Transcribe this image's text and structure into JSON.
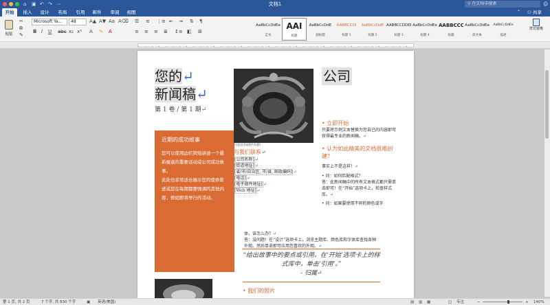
{
  "window": {
    "title": "文档1",
    "search_placeholder": "在文档中搜索"
  },
  "tabs": [
    {
      "label": "开始",
      "active": true
    },
    {
      "label": "插入"
    },
    {
      "label": "设计"
    },
    {
      "label": "布局"
    },
    {
      "label": "引用"
    },
    {
      "label": "邮件"
    },
    {
      "label": "审阅"
    },
    {
      "label": "视图"
    }
  ],
  "share_label": "共享",
  "ribbon": {
    "paste_label": "粘贴",
    "font_name": "Microsoft Ya...",
    "font_size": "48",
    "styles": [
      {
        "sample": "AaBbCcDdEe",
        "name": "正文"
      },
      {
        "sample": "AAI",
        "name": "标题"
      },
      {
        "sample": "AaBbCcDdE",
        "name": "副标题"
      },
      {
        "sample": "AABBCCDI",
        "name": "标题 1"
      },
      {
        "sample": "AaBbCcDdE",
        "name": "标题 2"
      },
      {
        "sample": "AABBCCDDEE",
        "name": "标题 3"
      },
      {
        "sample": "AaBbCcDdEe",
        "name": "标题 4"
      },
      {
        "sample": "AABBCCC",
        "name": "标题"
      },
      {
        "sample": "AaBbCcDdEe",
        "name": "段文本"
      },
      {
        "sample": "AaBbCcDdEe",
        "name": "描述"
      }
    ],
    "styles_pane_label": "样式窗格"
  },
  "document": {
    "title_line1": "您的",
    "title_line2": "新闻稿",
    "issue": "第 1 卷 / 第 1 期",
    "company": "公司",
    "story_box": {
      "heading": "近期的成功故事",
      "para1": "您可以使用边栏简短讲述一个最新报道的重要话动或公司成功故事。",
      "para2": "此处也非常适合展示您的使命陈述或您在每期都要强调的其他内容，例如即将举行的活动。"
    },
    "photo_caption": "[在此处添加图片标题]",
    "contact": {
      "heading": "与我们联系",
      "lines": [
        "[公司名称]",
        "[街道地址]",
        "[省/市/自治区, 市/县, 邮政编码]",
        "[电话]",
        "[电子邮件地址]",
        "[Web 地址]"
      ]
    },
    "section1": {
      "heading": "立即开始",
      "body": "只要将示例文本替换为您自己的内容即可获得最专业的新闻稿。"
    },
    "section2": {
      "heading": "认为如此精美的文档很难创建？",
      "intro": "事实上不是这样！",
      "q1": "问：如何匹配格式？",
      "a1": "答：此新闻稿中的所有文本格式都只需单击即可！在“开始”选项卡上，检查样式库。",
      "q2": "问：如果要使用不同的颜色或字"
    },
    "bottom_text_1": "体，该怎么办？",
    "bottom_text_2": "答：没问题！在“设计”选项卡上，浏览主题库、颜色库和字体库查找各种外观。然后单击即可应用您喜欢的外观。",
    "quote": "“给出故事中的要点或引用。在‘开始’选项卡上的样式库中，单击‘引用’。”",
    "quote_attribution": "- 归属",
    "bottom_heading": "我们的照片"
  },
  "status": {
    "page": "第 1 页, 共 2 页",
    "words": "7 个字, 共 830 个字",
    "language": "英语(美国)",
    "focus": "专注",
    "zoom": "140%"
  },
  "colors": {
    "brand": "#2b579a",
    "accent": "#d96b33"
  }
}
